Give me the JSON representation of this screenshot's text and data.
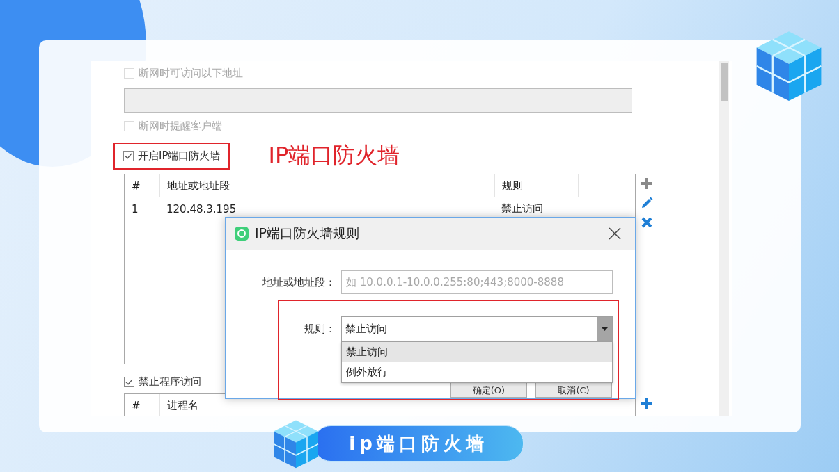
{
  "offline_access": {
    "label": "断网时可访问以下地址",
    "checked": false,
    "disabled": true
  },
  "offline_address_field": {
    "disabled": true
  },
  "offline_notify": {
    "label": "断网时提醒客户端",
    "checked": false,
    "disabled": true
  },
  "ip_firewall": {
    "label": "开启IP端口防火墙",
    "checked": true,
    "disabled": false
  },
  "annotation": "IP端口防火墙",
  "firewall_table": {
    "columns": [
      "#",
      "地址或地址段",
      "规则"
    ],
    "rows": [
      [
        "1",
        "120.48.3.195",
        "禁止访问"
      ]
    ]
  },
  "block_programs": {
    "label": "禁止程序访问",
    "checked": true,
    "disabled": false
  },
  "process_table": {
    "columns": [
      "#",
      "进程名"
    ]
  },
  "dialog": {
    "title": "IP端口防火墙规则",
    "address_label": "地址或地址段：",
    "address_placeholder": "如 10.0.0.1-10.0.0.255:80;443;8000-8888",
    "rule_label": "规则：",
    "rule_value": "禁止访问",
    "rule_options": [
      {
        "label": "禁止访问",
        "selected": true
      },
      {
        "label": "例外放行",
        "selected": false
      }
    ],
    "buttons": [
      "确定(O)",
      "取消(C)"
    ]
  },
  "banner": {
    "title": "ip端口防火墙"
  }
}
